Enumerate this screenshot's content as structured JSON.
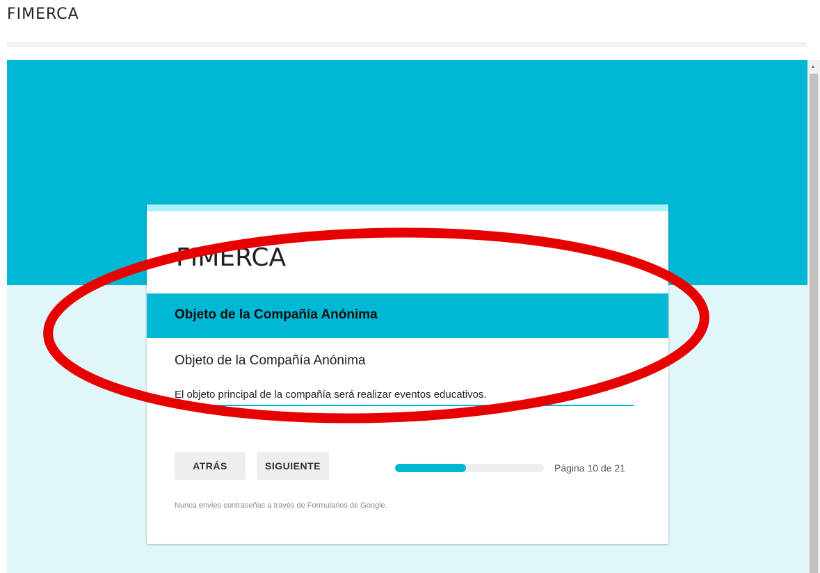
{
  "page": {
    "title": "FIMERCA"
  },
  "form": {
    "title": "FIMERCA",
    "section_title": "Objeto de la Compañía Anónima",
    "question": {
      "title": "Objeto de la Compañía Anónima",
      "answer": "El objeto principal de la compañía será realizar eventos educativos."
    },
    "buttons": {
      "back": "ATRÁS",
      "next": "SIGUIENTE"
    },
    "progress": {
      "fraction": 0.476,
      "label": "Página 10 de 21"
    },
    "warning": "Nunca envíes contraseñas a través de Formularios de Google."
  },
  "colors": {
    "accent": "#00b8d4",
    "background": "#e0f6f9",
    "card_top": "#a8f2fb",
    "annotation": "#e60000"
  }
}
